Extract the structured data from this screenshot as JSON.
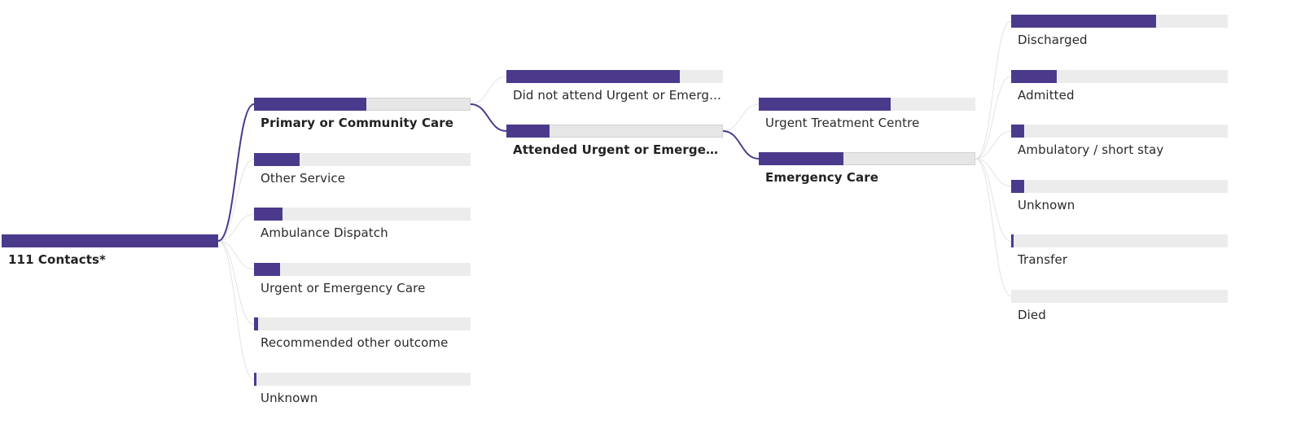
{
  "colors": {
    "bar_fill": "#4b3a8c",
    "bar_track": "#ececec",
    "selected_link": "#4b3a8c",
    "link": "#e3e3e3"
  },
  "chart_data": {
    "type": "decomposition-tree",
    "value_scale": "fraction of parent",
    "levels": [
      {
        "nodes": [
          {
            "id": "root",
            "label": "111 Contacts*",
            "value": 1.0,
            "root": true
          }
        ]
      },
      {
        "nodes": [
          {
            "id": "l1-primary",
            "parent": "root",
            "label": "Primary or Community Care",
            "value": 0.52,
            "on_path": true
          },
          {
            "id": "l1-other",
            "parent": "root",
            "label": "Other Service",
            "value": 0.21
          },
          {
            "id": "l1-ambulance",
            "parent": "root",
            "label": "Ambulance Dispatch",
            "value": 0.13
          },
          {
            "id": "l1-urgent",
            "parent": "root",
            "label": "Urgent or Emergency Care",
            "value": 0.12
          },
          {
            "id": "l1-recommended",
            "parent": "root",
            "label": "Recommended other outcome",
            "value": 0.02
          },
          {
            "id": "l1-unknown",
            "parent": "root",
            "label": "Unknown",
            "value": 0.01
          }
        ]
      },
      {
        "nodes": [
          {
            "id": "l2-didnot",
            "parent": "l1-primary",
            "label": "Did not attend Urgent or Emergen…",
            "value": 0.8
          },
          {
            "id": "l2-attended",
            "parent": "l1-primary",
            "label": "Attended Urgent or Emergency C…",
            "value": 0.2,
            "on_path": true
          }
        ]
      },
      {
        "nodes": [
          {
            "id": "l3-utc",
            "parent": "l2-attended",
            "label": "Urgent Treatment Centre",
            "value": 0.61
          },
          {
            "id": "l3-emergency",
            "parent": "l2-attended",
            "label": "Emergency Care",
            "value": 0.39,
            "on_path": true
          }
        ]
      },
      {
        "nodes": [
          {
            "id": "l4-discharged",
            "parent": "l3-emergency",
            "label": "Discharged",
            "value": 0.67
          },
          {
            "id": "l4-admitted",
            "parent": "l3-emergency",
            "label": "Admitted",
            "value": 0.21
          },
          {
            "id": "l4-ambulatory",
            "parent": "l3-emergency",
            "label": "Ambulatory / short stay",
            "value": 0.06
          },
          {
            "id": "l4-unknown",
            "parent": "l3-emergency",
            "label": "Unknown",
            "value": 0.06
          },
          {
            "id": "l4-transfer",
            "parent": "l3-emergency",
            "label": "Transfer",
            "value": 0.01
          },
          {
            "id": "l4-died",
            "parent": "l3-emergency",
            "label": "Died",
            "value": 0.0
          }
        ]
      }
    ]
  }
}
